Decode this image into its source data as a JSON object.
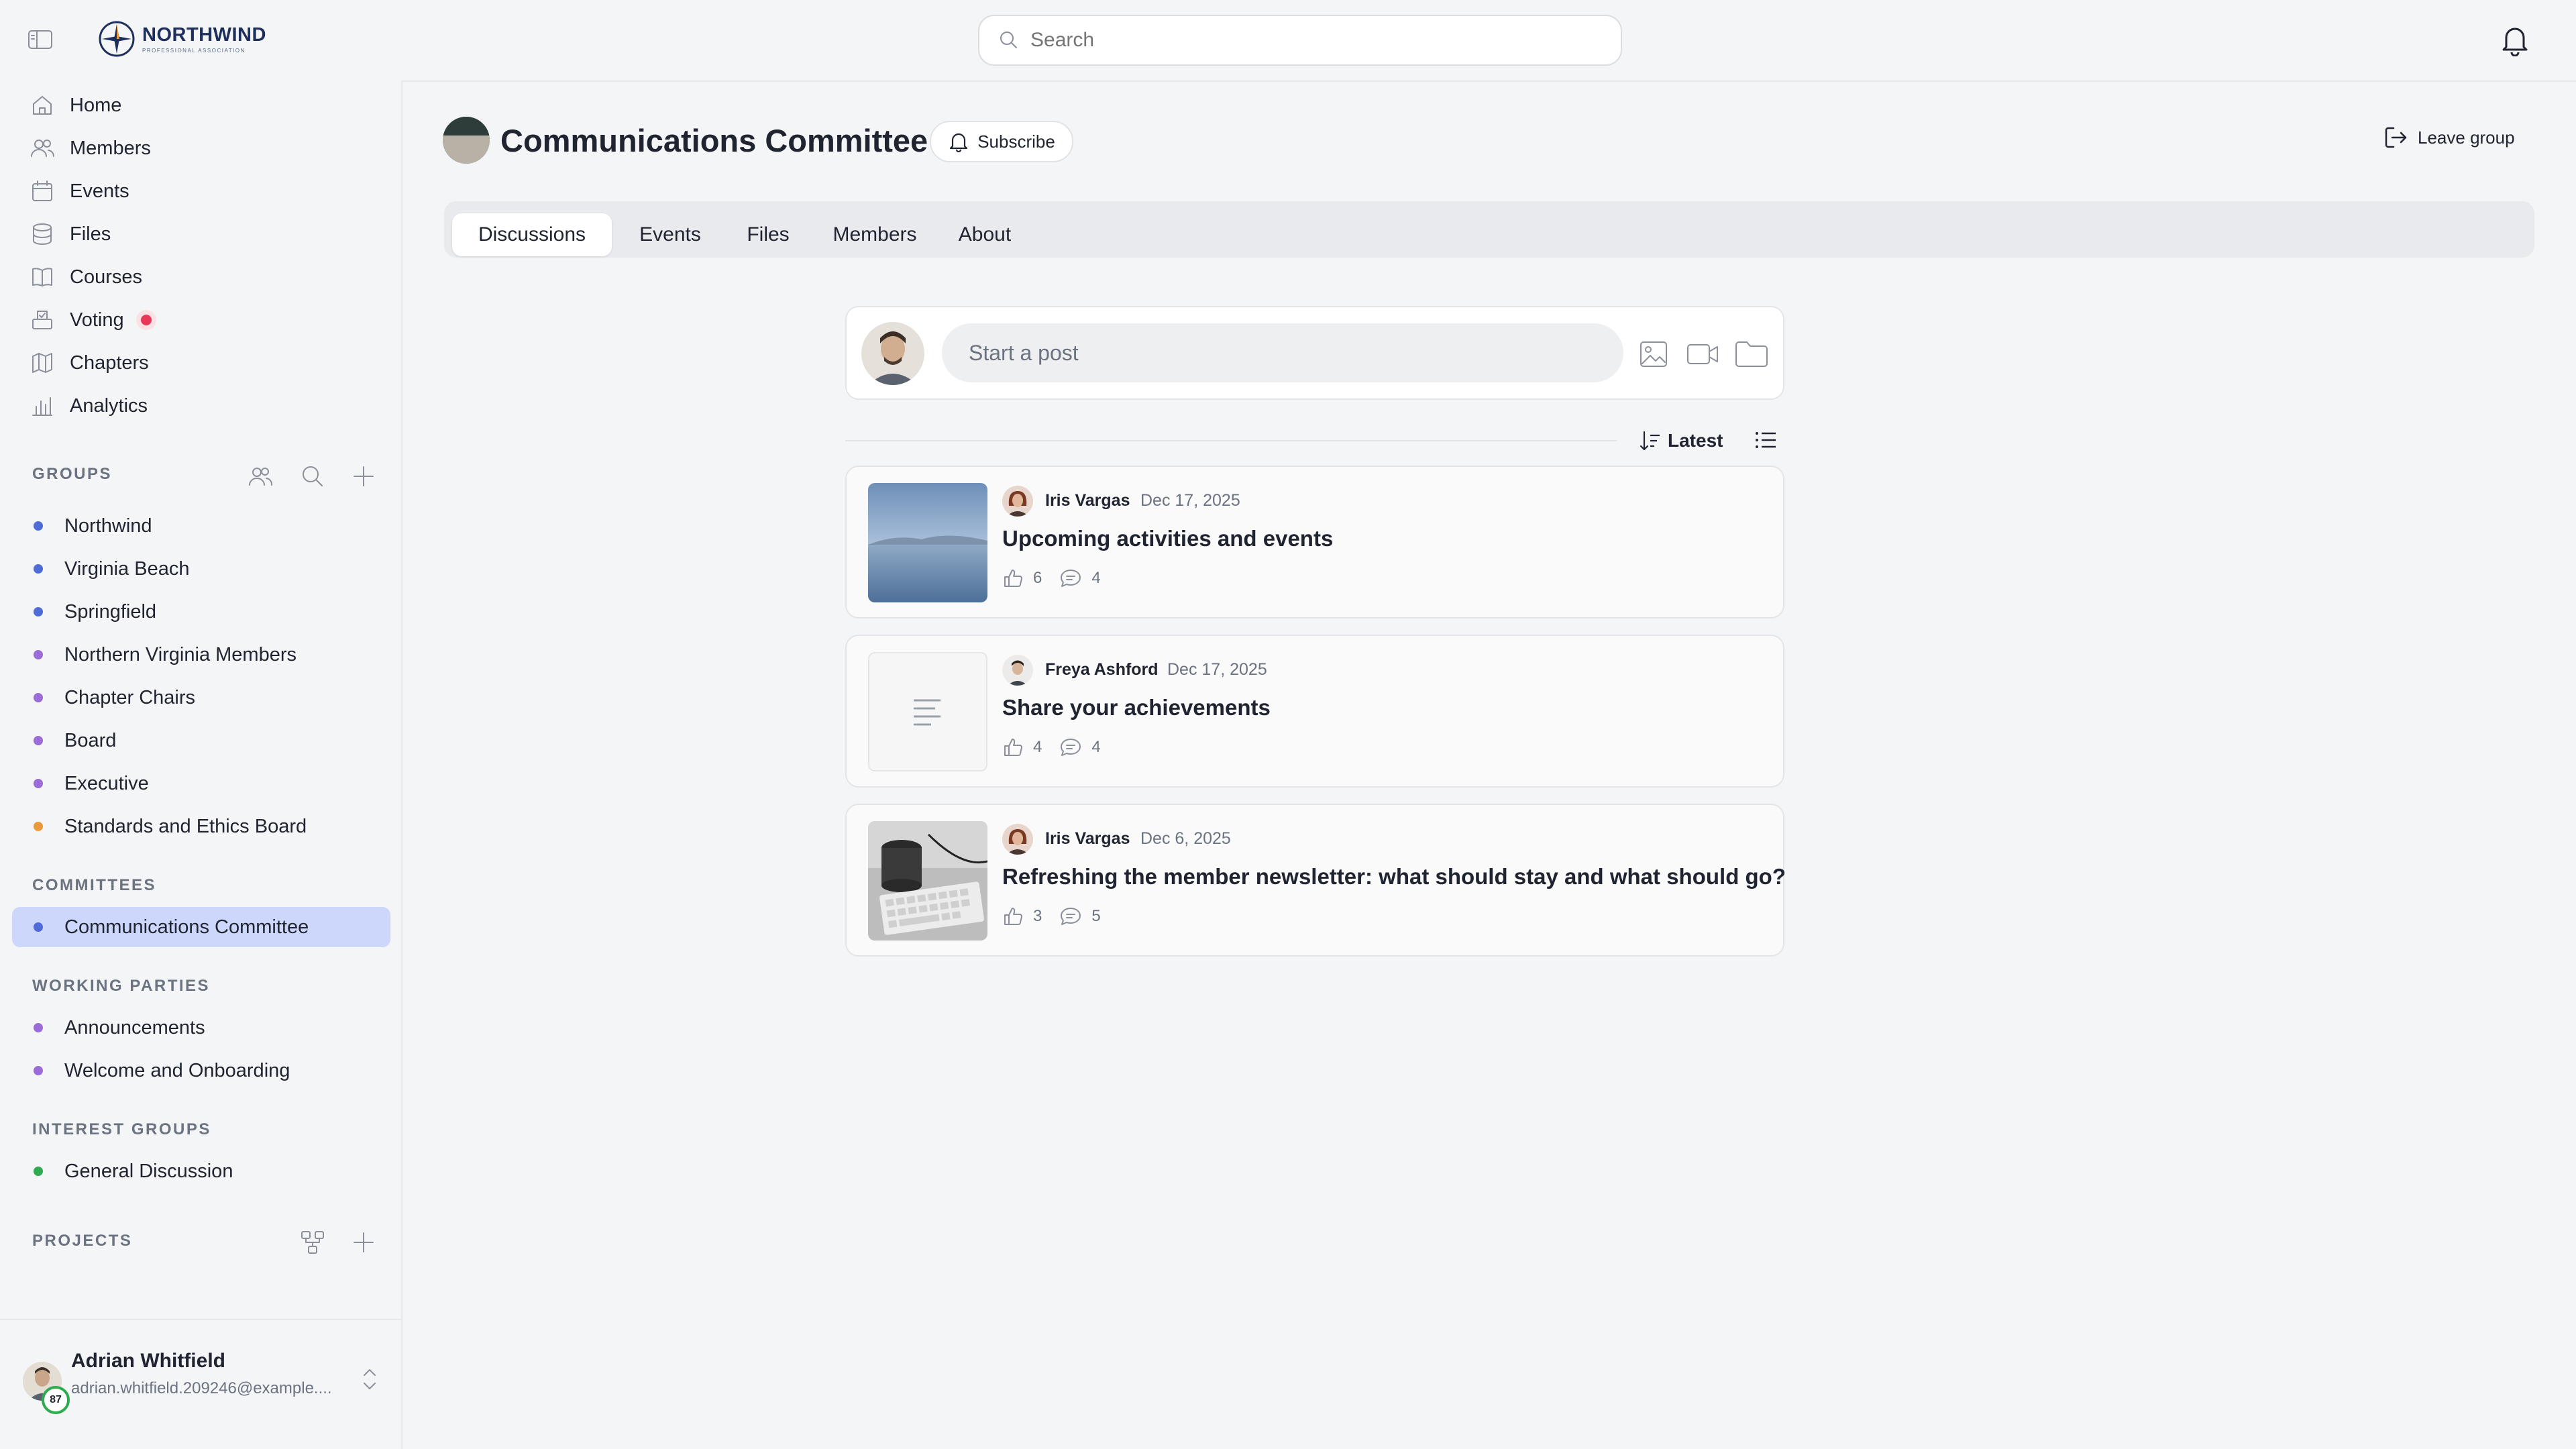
{
  "topbar": {
    "logo_name": "NORTHWIND",
    "logo_sub": "PROFESSIONAL ASSOCIATION",
    "search_placeholder": "Search"
  },
  "sidebar": {
    "nav": [
      {
        "label": "Home",
        "icon": "home-icon"
      },
      {
        "label": "Members",
        "icon": "users-icon"
      },
      {
        "label": "Events",
        "icon": "calendar-icon"
      },
      {
        "label": "Files",
        "icon": "database-icon"
      },
      {
        "label": "Courses",
        "icon": "book-icon"
      },
      {
        "label": "Voting",
        "icon": "ballot-icon"
      },
      {
        "label": "Chapters",
        "icon": "map-icon"
      },
      {
        "label": "Analytics",
        "icon": "chart-icon"
      }
    ],
    "groups_label": "GROUPS",
    "groups": [
      {
        "label": "Northwind",
        "color": "#4f6bd8"
      },
      {
        "label": "Virginia Beach",
        "color": "#4f6bd8"
      },
      {
        "label": "Springfield",
        "color": "#4f6bd8"
      },
      {
        "label": "Northern Virginia Members",
        "color": "#9b6bd8"
      },
      {
        "label": "Chapter Chairs",
        "color": "#9b6bd8"
      },
      {
        "label": "Board",
        "color": "#9b6bd8"
      },
      {
        "label": "Executive",
        "color": "#9b6bd8"
      },
      {
        "label": "Standards and Ethics Board",
        "color": "#e89a3c"
      }
    ],
    "committees_label": "COMMITTEES",
    "committees": [
      {
        "label": "Communications Committee",
        "color": "#4f6bd8"
      }
    ],
    "working_label": "WORKING PARTIES",
    "working": [
      {
        "label": "Announcements",
        "color": "#9b6bd8"
      },
      {
        "label": "Welcome and Onboarding",
        "color": "#9b6bd8"
      }
    ],
    "interest_label": "INTEREST GROUPS",
    "interest": [
      {
        "label": "General Discussion",
        "color": "#2eaa4f"
      }
    ],
    "projects_label": "PROJECTS",
    "user": {
      "name": "Adrian Whitfield",
      "email": "adrian.whitfield.209246@example....",
      "badge": "87"
    }
  },
  "group": {
    "title": "Communications Committee",
    "subscribe_label": "Subscribe",
    "leave_label": "Leave group",
    "tabs": [
      "Discussions",
      "Events",
      "Files",
      "Members",
      "About"
    ],
    "composer_placeholder": "Start a post",
    "sort_label": "Latest"
  },
  "posts": [
    {
      "author": "Iris Vargas",
      "date": "Dec 17, 2025",
      "title": "Upcoming activities and events",
      "likes": "6",
      "comments": "4"
    },
    {
      "author": "Freya Ashford",
      "date": "Dec 17, 2025",
      "title": "Share your achievements",
      "likes": "4",
      "comments": "4"
    },
    {
      "author": "Iris Vargas",
      "date": "Dec 6, 2025",
      "title": "Refreshing the member newsletter: what should stay and what should go?",
      "likes": "3",
      "comments": "5"
    }
  ],
  "colors": {
    "accent": "#4f6bd8",
    "active_bg": "#cdd6fb",
    "voting_dot": "#e8385a"
  }
}
